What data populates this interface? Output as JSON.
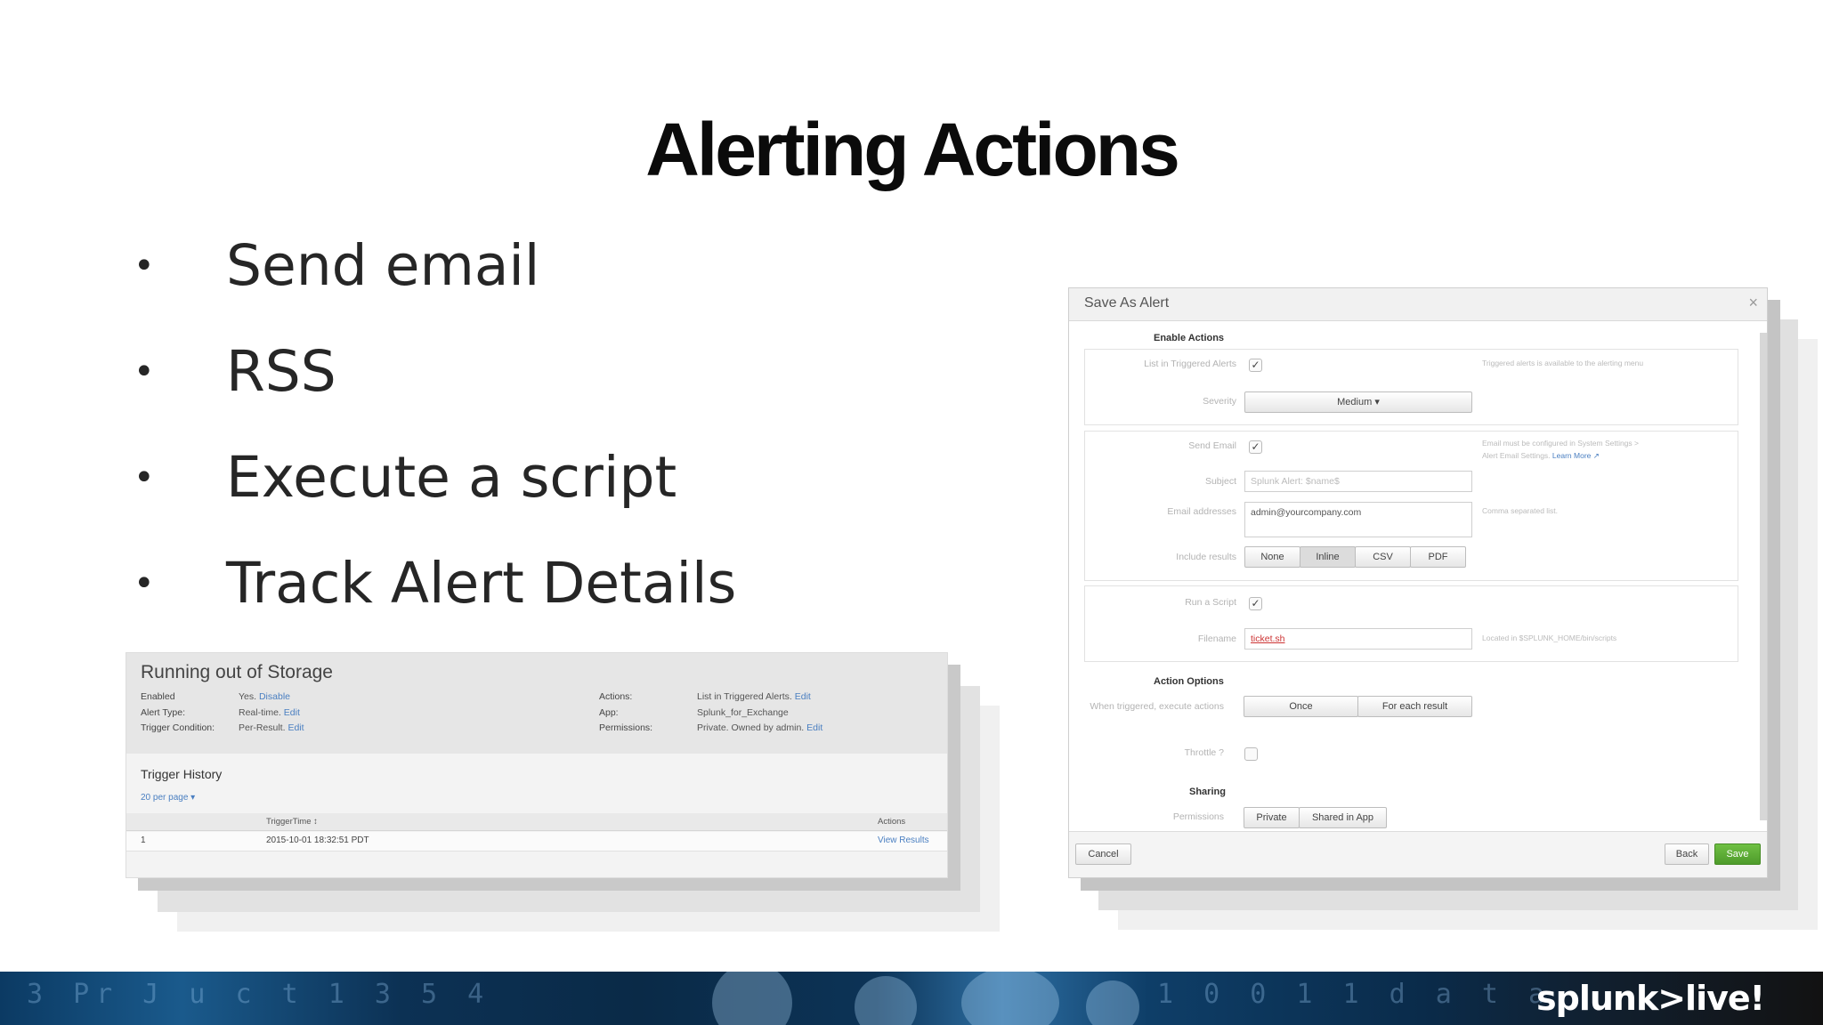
{
  "slide": {
    "title": "Alerting Actions",
    "bullets": [
      "Send email",
      "RSS",
      "Execute a script",
      "Track Alert Details"
    ]
  },
  "alert_details": {
    "name": "Running out of Storage",
    "left_meta": [
      {
        "key": "Enabled",
        "value": "Yes.",
        "link": "Disable"
      },
      {
        "key": "Alert Type:",
        "value": "Real-time.",
        "link": "Edit"
      },
      {
        "key": "Trigger Condition:",
        "value": "Per-Result.",
        "link": "Edit"
      }
    ],
    "right_meta": [
      {
        "key": "Actions:",
        "value": "List in Triggered Alerts.",
        "link": "Edit"
      },
      {
        "key": "App:",
        "value": "Splunk_for_Exchange",
        "link": ""
      },
      {
        "key": "Permissions:",
        "value": "Private. Owned by admin.",
        "link": "Edit"
      }
    ],
    "trigger_history_title": "Trigger History",
    "per_page": "20 per page ▾",
    "table": {
      "headers": [
        "",
        "TriggerTime ↕",
        "Actions"
      ],
      "rows": [
        [
          "1",
          "2015-10-01 18:32:51 PDT",
          "View Results"
        ]
      ]
    }
  },
  "dialog": {
    "title": "Save As Alert",
    "close": "×",
    "enable_actions_label": "Enable Actions",
    "list_triggered_label": "List in Triggered Alerts",
    "list_triggered_hint": "Triggered alerts is available to the alerting menu",
    "severity_label": "Severity",
    "severity_value": "Medium ▾",
    "send_email_label": "Send Email",
    "send_email_hint": "Email must be configured in System Settings >",
    "send_email_hint2": "Alert Email Settings.",
    "send_email_hint_link": "Learn More ↗",
    "subject_label": "Subject",
    "subject_value": "Splunk Alert: $name$",
    "email_label": "Email addresses",
    "email_value": "admin@yourcompany.com",
    "email_hint": "Comma separated list.",
    "include_results_label": "Include results",
    "include_options": [
      "None",
      "Inline",
      "CSV",
      "PDF"
    ],
    "run_script_label": "Run a Script",
    "filename_label": "Filename",
    "filename_value": "ticket.sh",
    "filename_hint": "Located in $SPLUNK_HOME/bin/scripts",
    "action_options_label": "Action Options",
    "when_triggered_label": "When triggered, execute actions",
    "trigger_options": [
      "Once",
      "For each result"
    ],
    "throttle_label": "Throttle ?",
    "sharing_label": "Sharing",
    "permissions_label": "Permissions",
    "permission_options": [
      "Private",
      "Shared in App"
    ],
    "cancel": "Cancel",
    "back": "Back",
    "save": "Save"
  },
  "footer": {
    "logo": "splunk>live!",
    "code_text": "3 Pr  J u c t  1 3   5 4",
    "code_text2": "1 0   0 1 1   d a t a"
  }
}
